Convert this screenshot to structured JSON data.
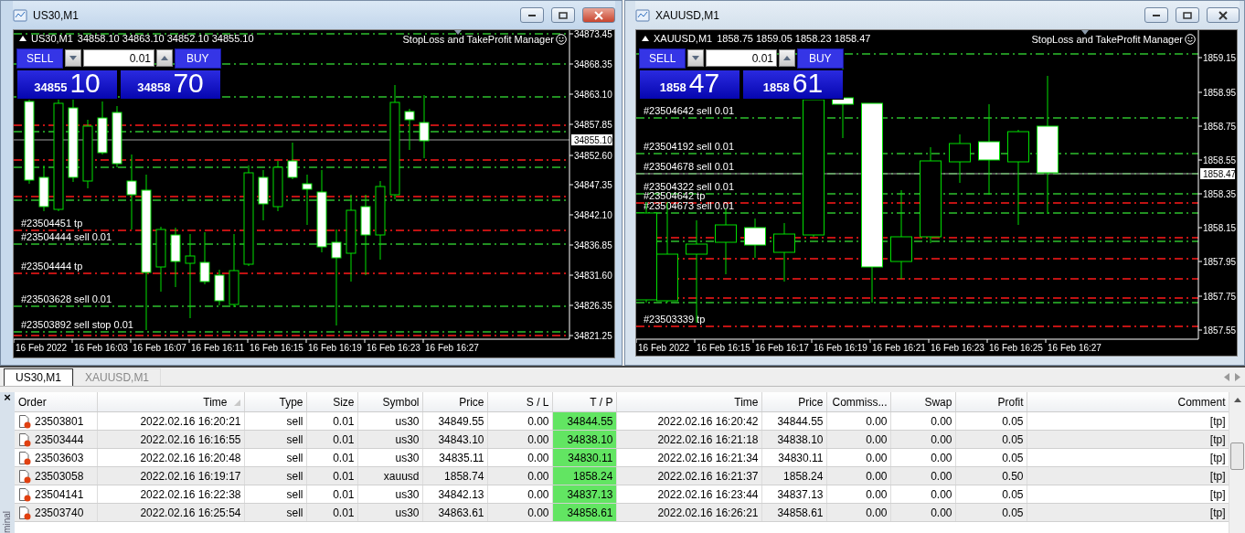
{
  "windows": [
    {
      "title": "US30,M1",
      "active": true,
      "chart": {
        "symbol": "US30,M1",
        "ohlc": "34858.10 34863.10 34852.10 34855.10",
        "expert": "StopLoss and TakeProfit Manager",
        "trade_panel": {
          "sell": "SELL",
          "lot": "0.01",
          "buy": "BUY",
          "bid_big": "34855",
          "bid_pips": "10",
          "ask_big": "34858",
          "ask_pips": "70"
        },
        "price_ticks": [
          "34873.45",
          "34868.35",
          "34863.10",
          "34857.85",
          "34852.60",
          "34847.35",
          "34842.10",
          "34836.85",
          "34831.60",
          "34826.35",
          "34821.25"
        ],
        "current_price": "34855.10",
        "time_labels": [
          "16 Feb 2022",
          "16 Feb 16:03",
          "16 Feb 16:07",
          "16 Feb 16:11",
          "16 Feb 16:15",
          "16 Feb 16:19",
          "16 Feb 16:23",
          "16 Feb 16:27"
        ],
        "order_lines": [
          {
            "kind": "sell"
          },
          {
            "kind": "sell"
          },
          {
            "kind": "sell"
          },
          {
            "kind": "tp"
          },
          {
            "kind": "sell"
          },
          {
            "kind": "tp"
          },
          {
            "kind": "sell"
          },
          {
            "kind": "tp"
          },
          {
            "kind": "sell"
          },
          {
            "kind": "tp",
            "label": "#23504451 tp"
          },
          {
            "kind": "sell",
            "label": "#23504444 sell 0.01"
          },
          {
            "kind": "tp",
            "label": "#23504444 tp"
          },
          {
            "kind": "sell",
            "label": "#23503628 sell 0.01"
          },
          {
            "kind": "sell",
            "label": "#23503892 sell stop 0.01"
          },
          {
            "kind": "tp"
          }
        ]
      }
    },
    {
      "title": "XAUUSD,M1",
      "active": false,
      "chart": {
        "symbol": "XAUUSD,M1",
        "ohlc": "1858.75 1859.05 1858.23 1858.47",
        "expert": "StopLoss and TakeProfit Manager",
        "trade_panel": {
          "sell": "SELL",
          "lot": "0.01",
          "buy": "BUY",
          "bid_big": "1858",
          "bid_pips": "47",
          "ask_big": "1858",
          "ask_pips": "61"
        },
        "price_ticks": [
          "1859.15",
          "1858.95",
          "1858.75",
          "1858.55",
          "1858.35",
          "1858.15",
          "1857.95",
          "1857.75",
          "1857.55"
        ],
        "current_price": "1858.47",
        "time_labels": [
          "16 Feb 2022",
          "16 Feb 16:15",
          "16 Feb 16:17",
          "16 Feb 16:19",
          "16 Feb 16:21",
          "16 Feb 16:23",
          "16 Feb 16:25",
          "16 Feb 16:27"
        ],
        "order_lines": [
          {
            "kind": "sell"
          },
          {
            "kind": "sell",
            "label": "#23504642 sell 0.01"
          },
          {
            "kind": "sell",
            "label": "#23504192 sell 0.01"
          },
          {
            "kind": "sell",
            "label": "#23504678 sell 0.01"
          },
          {
            "kind": "sell",
            "label": "#23504322 sell 0.01"
          },
          {
            "kind": "tp",
            "label": "#23504642 tp"
          },
          {
            "kind": "sell",
            "label": "#23504673 sell 0.01"
          },
          {
            "kind": "tp"
          },
          {
            "kind": "sell"
          },
          {
            "kind": "tp"
          },
          {
            "kind": "tp"
          },
          {
            "kind": "tp"
          },
          {
            "kind": "sell"
          },
          {
            "kind": "tp",
            "label": "#23503339 tp"
          }
        ]
      }
    }
  ],
  "terminal": {
    "close": "×",
    "side_label": "minal",
    "tabs": [
      {
        "label": "US30,M1",
        "selected": true
      },
      {
        "label": "XAUUSD,M1",
        "selected": false
      }
    ],
    "table": {
      "columns": [
        {
          "label": "Order",
          "sorted": false,
          "highlighted": false
        },
        {
          "label": "Time",
          "sorted": true,
          "highlighted": false
        },
        {
          "label": "Type",
          "sorted": false,
          "highlighted": false
        },
        {
          "label": "Size",
          "sorted": false,
          "highlighted": false
        },
        {
          "label": "Symbol",
          "sorted": false,
          "highlighted": false
        },
        {
          "label": "Price",
          "sorted": false,
          "highlighted": false
        },
        {
          "label": "S / L",
          "sorted": false,
          "highlighted": false
        },
        {
          "label": "T / P",
          "sorted": false,
          "highlighted": true
        },
        {
          "label": "Time",
          "sorted": false,
          "highlighted": false
        },
        {
          "label": "Price",
          "sorted": false,
          "highlighted": false
        },
        {
          "label": "Commiss...",
          "sorted": false,
          "highlighted": false
        },
        {
          "label": "Swap",
          "sorted": false,
          "highlighted": false
        },
        {
          "label": "Profit",
          "sorted": false,
          "highlighted": false
        },
        {
          "label": "Comment",
          "sorted": false,
          "highlighted": false
        }
      ],
      "rows": [
        [
          "23503801",
          "2022.02.16 16:20:21",
          "sell",
          "0.01",
          "us30",
          "34849.55",
          "0.00",
          "34844.55",
          "2022.02.16 16:20:42",
          "34844.55",
          "0.00",
          "0.00",
          "0.05",
          "[tp]"
        ],
        [
          "23503444",
          "2022.02.16 16:16:55",
          "sell",
          "0.01",
          "us30",
          "34843.10",
          "0.00",
          "34838.10",
          "2022.02.16 16:21:18",
          "34838.10",
          "0.00",
          "0.00",
          "0.05",
          "[tp]"
        ],
        [
          "23503603",
          "2022.02.16 16:20:48",
          "sell",
          "0.01",
          "us30",
          "34835.11",
          "0.00",
          "34830.11",
          "2022.02.16 16:21:34",
          "34830.11",
          "0.00",
          "0.00",
          "0.05",
          "[tp]"
        ],
        [
          "23503058",
          "2022.02.16 16:19:17",
          "sell",
          "0.01",
          "xauusd",
          "1858.74",
          "0.00",
          "1858.24",
          "2022.02.16 16:21:37",
          "1858.24",
          "0.00",
          "0.00",
          "0.50",
          "[tp]"
        ],
        [
          "23504141",
          "2022.02.16 16:22:38",
          "sell",
          "0.01",
          "us30",
          "34842.13",
          "0.00",
          "34837.13",
          "2022.02.16 16:23:44",
          "34837.13",
          "0.00",
          "0.00",
          "0.05",
          "[tp]"
        ],
        [
          "23503740",
          "2022.02.16 16:25:54",
          "sell",
          "0.01",
          "us30",
          "34863.61",
          "0.00",
          "34858.61",
          "2022.02.16 16:26:21",
          "34858.61",
          "0.00",
          "0.00",
          "0.05",
          "[tp]"
        ]
      ]
    }
  }
}
